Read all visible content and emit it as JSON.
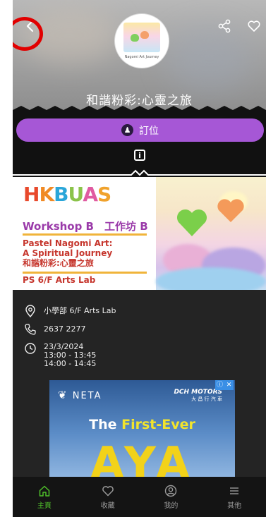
{
  "header": {
    "title": "和諧粉彩:心靈之旅",
    "logo_caption": "Nagomi Art Journey",
    "logo_mark": "HKBUAS"
  },
  "booking": {
    "label": "訂位"
  },
  "banner": {
    "brand": "HKBUAS",
    "workshop": "Workshop B　工作坊 B",
    "title_en_1": "Pastel Nagomi Art:",
    "title_en_2": "A Spiritual Journey",
    "title_zh": "和諧粉彩:心靈之旅",
    "venue": "PS 6/F Arts Lab"
  },
  "details": {
    "location": "小學部 6/F Arts Lab",
    "phone": "2637 2277",
    "date": "23/3/2024",
    "time_1": "13:00 - 13:45",
    "time_2": "14:00 - 14:45"
  },
  "ad": {
    "brand_left": "NETA",
    "brand_right": "DCH MOTORS",
    "brand_right_sub": "大 昌 行 汽 車",
    "tagline_white": "The ",
    "tagline_yellow": "First-Ever",
    "big": "AYA"
  },
  "nav": {
    "items": [
      {
        "label": "主頁",
        "icon": "home-icon"
      },
      {
        "label": "收藏",
        "icon": "heart-icon"
      },
      {
        "label": "我的",
        "icon": "user-icon"
      },
      {
        "label": "其他",
        "icon": "menu-icon"
      }
    ]
  },
  "colors": {
    "accent": "#a657d6",
    "nav_active": "#4fbf2a",
    "highlight_ring": "#e10000"
  }
}
